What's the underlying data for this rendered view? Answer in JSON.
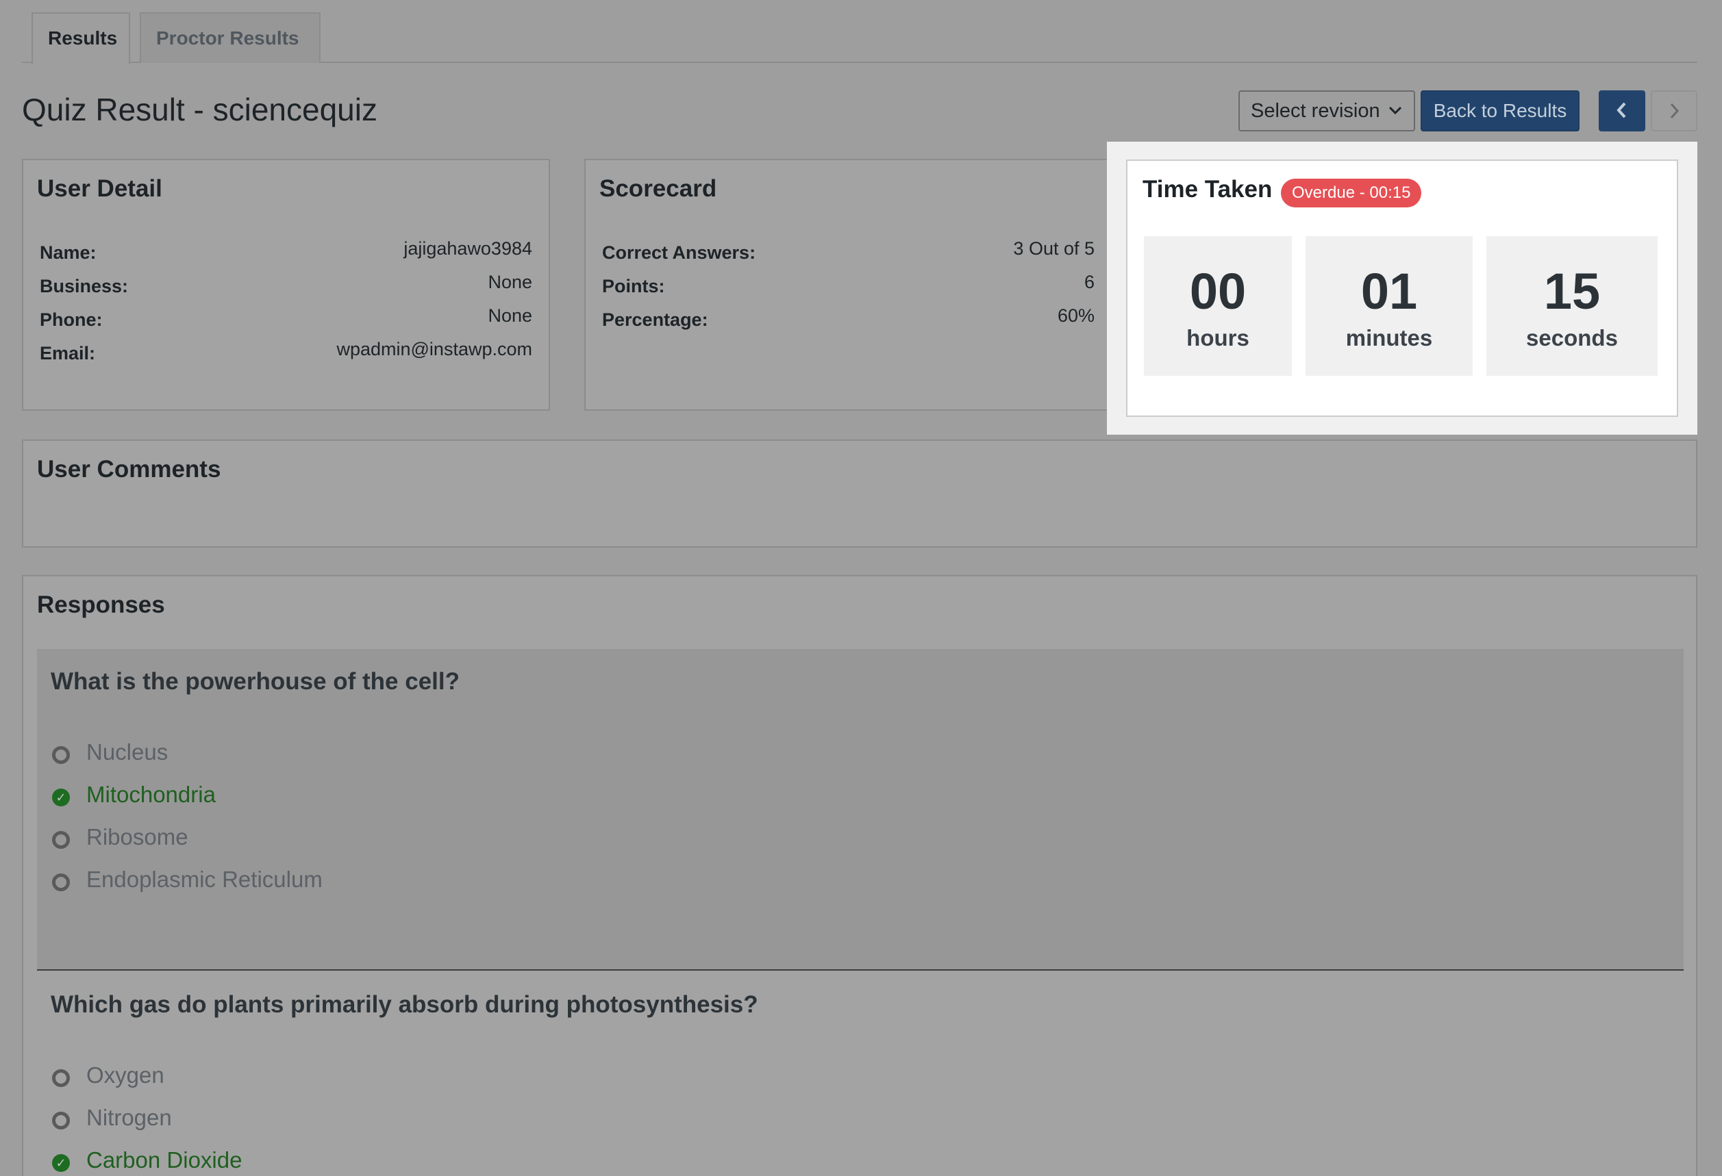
{
  "tabs": [
    {
      "label": "Results",
      "active": true
    },
    {
      "label": "Proctor Results",
      "active": false
    }
  ],
  "header": {
    "title": "Quiz Result - sciencequiz",
    "revision_select": "Select revision",
    "back_button": "Back to Results",
    "prev_icon": "chevron-left-icon",
    "next_icon": "chevron-right-icon"
  },
  "user_detail": {
    "title": "User Detail",
    "rows": [
      {
        "label": "Name:",
        "value": "jajigahawo3984"
      },
      {
        "label": "Business:",
        "value": "None"
      },
      {
        "label": "Phone:",
        "value": "None"
      },
      {
        "label": "Email:",
        "value": "wpadmin@instawp.com"
      }
    ]
  },
  "scorecard": {
    "title": "Scorecard",
    "rows": [
      {
        "label": "Correct Answers:",
        "value": "3 Out of 5"
      },
      {
        "label": "Points:",
        "value": "6"
      },
      {
        "label": "Percentage:",
        "value": "60%"
      }
    ]
  },
  "time_taken": {
    "title": "Time Taken",
    "badge": "Overdue - 00:15",
    "hours": "00",
    "hours_label": "hours",
    "minutes": "01",
    "minutes_label": "minutes",
    "seconds": "15",
    "seconds_label": "seconds"
  },
  "comments": {
    "title": "User Comments"
  },
  "responses": {
    "title": "Responses",
    "questions": [
      {
        "text": "What is the powerhouse of the cell?",
        "options": [
          {
            "label": "Nucleus",
            "correct": false
          },
          {
            "label": "Mitochondria",
            "correct": true
          },
          {
            "label": "Ribosome",
            "correct": false
          },
          {
            "label": "Endoplasmic Reticulum",
            "correct": false
          }
        ]
      },
      {
        "text": "Which gas do plants primarily absorb during photosynthesis?",
        "options": [
          {
            "label": "Oxygen",
            "correct": false
          },
          {
            "label": "Nitrogen",
            "correct": false
          },
          {
            "label": "Carbon Dioxide",
            "correct": true
          }
        ]
      }
    ]
  },
  "colors": {
    "primary": "#22446c",
    "overdue": "#e65054",
    "correct": "#1e6b22"
  }
}
